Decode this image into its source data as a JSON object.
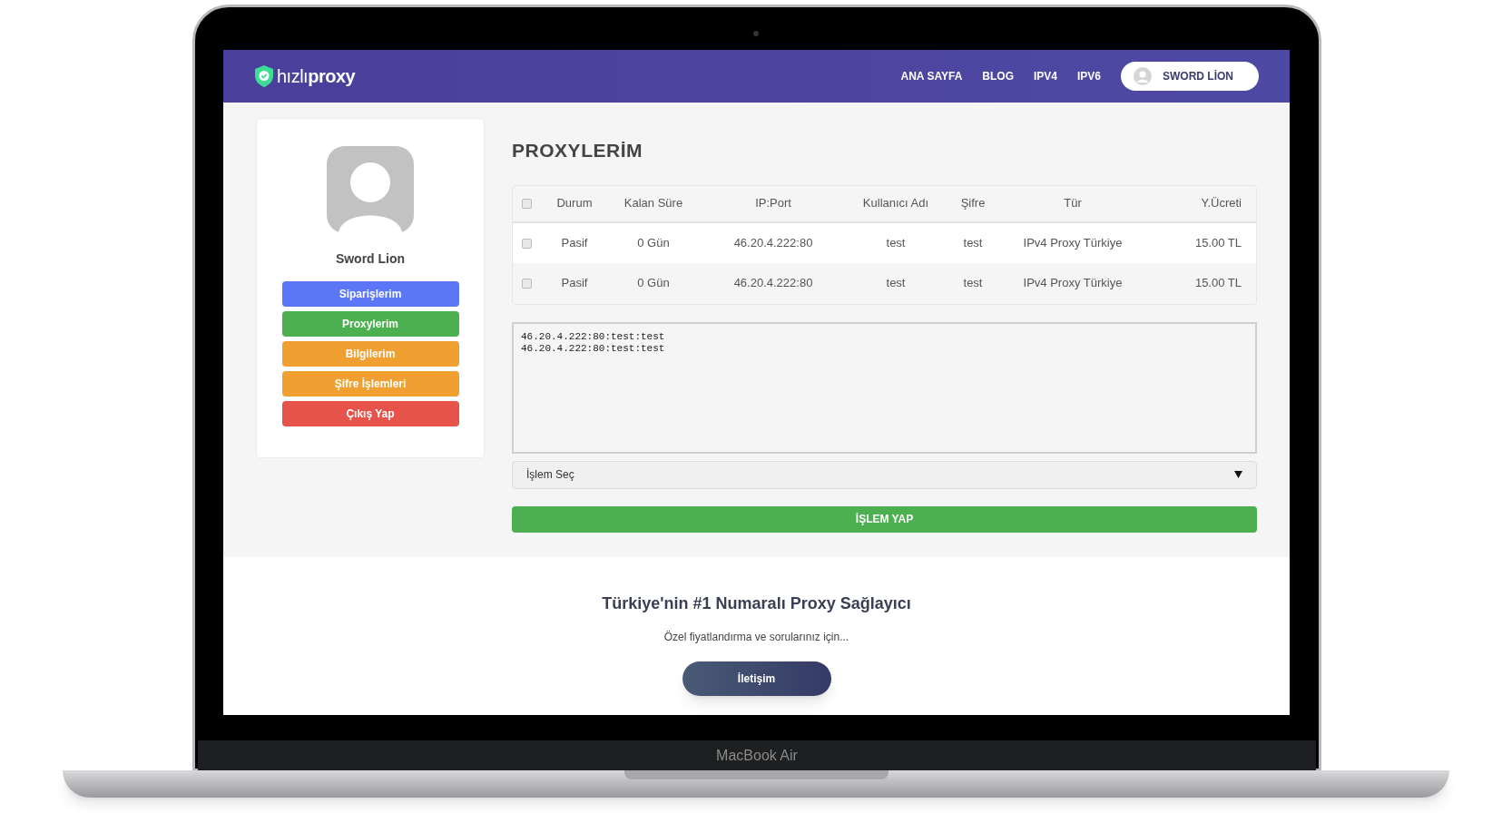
{
  "navbar": {
    "brand": "hızlı**proxy**",
    "links": [
      "ANA SAYFA",
      "BLOG",
      "IPV4",
      "IPV6"
    ],
    "user_button": "SWORD LİON"
  },
  "sidebar": {
    "user_name": "Sword Lion",
    "menu": [
      {
        "label": "Siparişlerim",
        "color": "#5b76f7"
      },
      {
        "label": "Proxylerim",
        "color": "#4caf50"
      },
      {
        "label": "Bilgilerim",
        "color": "#f0a030"
      },
      {
        "label": "Şifre İşlemleri",
        "color": "#f0a030"
      },
      {
        "label": "Çıkış Yap",
        "color": "#e5534b"
      }
    ]
  },
  "main": {
    "title": "PROXYLERİM",
    "table": {
      "select_all_checked": false,
      "columns": [
        "Durum",
        "Kalan Süre",
        "IP:Port",
        "Kullanıcı Adı",
        "Şifre",
        "Tür",
        "Y.Ücreti"
      ],
      "rows": [
        {
          "checked": false,
          "cells": [
            "Pasif",
            "0 Gün",
            "46.20.4.222:80",
            "test",
            "test",
            "IPv4 Proxy Türkiye",
            "15.00 TL"
          ]
        },
        {
          "checked": false,
          "cells": [
            "Pasif",
            "0 Gün",
            "46.20.4.222:80",
            "test",
            "test",
            "IPv4 Proxy Türkiye",
            "15.00 TL"
          ]
        }
      ]
    },
    "export_lines": [
      "46.20.4.222:80:test:test",
      "46.20.4.222:80:test:test"
    ],
    "action_select": "İşlem Seç",
    "action_button": "İŞLEM YAP"
  },
  "footer": {
    "heading": "Türkiye'nin #1 Numaralı Proxy Sağlayıcı",
    "subtitle": "Özel fiyatlandırma ve sorularınız için...",
    "contact_button": "İletişim"
  },
  "device_label": "MacBook Air"
}
